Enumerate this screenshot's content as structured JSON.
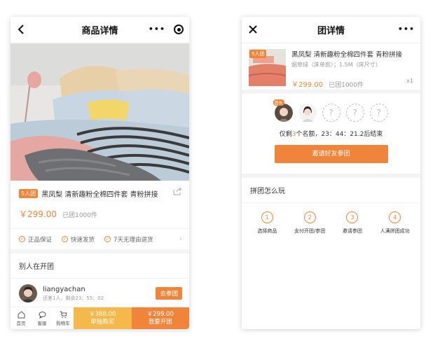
{
  "left": {
    "nav": {
      "title": "商品详情",
      "menu_dots": "•••"
    },
    "product": {
      "tag": "5人团",
      "title": "黑凤梨 清新趣粉全棉四件套 青粉拼接",
      "price": "￥299.00",
      "sold": "已团1000件"
    },
    "guarantees": [
      "正品保证",
      "快速发货",
      "7天无理由退货"
    ],
    "others": {
      "title": "别人在开团",
      "group": {
        "username": "liangyachan",
        "remain": "还差1人，剩余23：55：02",
        "join_label": "去参团"
      }
    },
    "bottom": {
      "tabs": [
        {
          "label": "首页",
          "icon": "home-icon"
        },
        {
          "label": "客服",
          "icon": "chat-icon"
        },
        {
          "label": "购物车",
          "icon": "cart-icon"
        }
      ],
      "alone": {
        "price": "￥388.00",
        "label": "单独购买"
      },
      "open": {
        "price": "￥299.00",
        "label": "我要开团"
      }
    }
  },
  "right": {
    "nav": {
      "title": "团详情",
      "menu_dots": "•••"
    },
    "order": {
      "tag": "5人团",
      "title": "黑凤梨 清新趣粉全棉四件套 青粉拼接",
      "spec": "烟草绿（床单款）；1.5M（床尺寸）",
      "price": "￥299.00",
      "sold": "已团1000件",
      "qty": "x1"
    },
    "group": {
      "leader_badge": "团长",
      "empty_slot": "?",
      "countdown_prefix": "仅剩",
      "countdown_num": "3",
      "countdown_suffix": "个名额，23：44：21.2后结束",
      "invite_label": "邀请好友参团"
    },
    "how": {
      "title": "拼团怎么玩",
      "steps": [
        {
          "num": "1",
          "label": "选择商品"
        },
        {
          "num": "2",
          "label": "支付开团/参团"
        },
        {
          "num": "3",
          "label": "邀请参团"
        },
        {
          "num": "4",
          "label": "人满拼团成功"
        }
      ]
    }
  },
  "colors": {
    "accent": "#f0843a",
    "alone": "#f5b84a"
  }
}
